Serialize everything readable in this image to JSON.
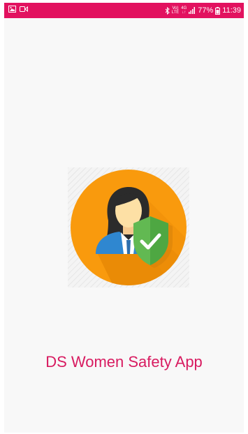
{
  "status_bar": {
    "background": "#e2125f",
    "left_icons": [
      "gallery-icon",
      "video-icon"
    ],
    "right_icons": [
      "bluetooth-icon",
      "volte-icon",
      "4g-data-icon",
      "signal-icon",
      "battery-icon"
    ],
    "volte_top": "Vo)",
    "volte_bottom": "LTE",
    "data_top": "4G",
    "data_bottom": "↓↑",
    "battery": "77%",
    "time": "11:39"
  },
  "splash": {
    "logo_icon": "woman-safety-shield-icon",
    "logo_colors": {
      "circle": "#f99a0d",
      "shield": "#62b952",
      "suit": "#2f87d0"
    },
    "app_name": "DS Women Safety App",
    "app_name_color": "#d81b60"
  }
}
